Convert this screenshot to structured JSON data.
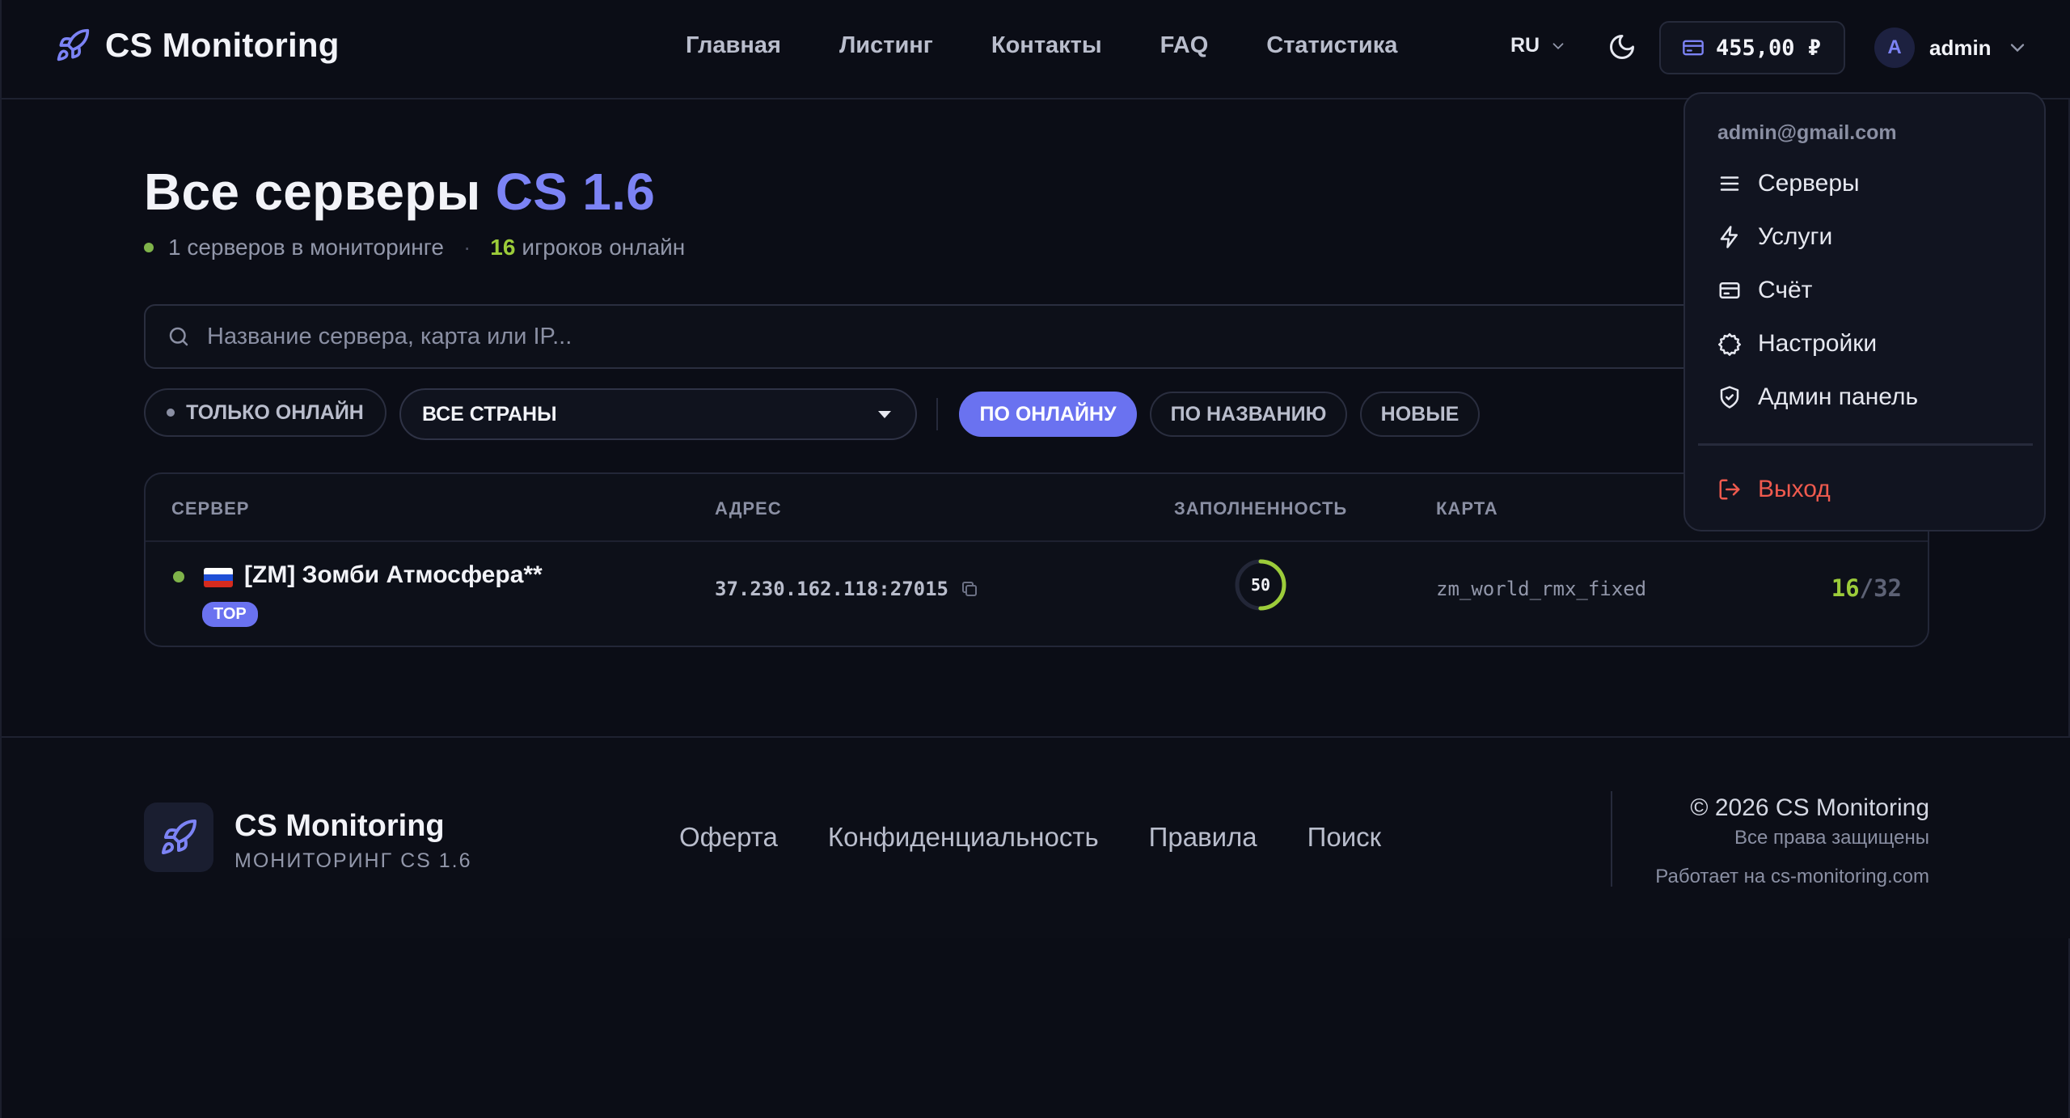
{
  "header": {
    "brand": "CS Monitoring",
    "nav": [
      "Главная",
      "Листинг",
      "Контакты",
      "FAQ",
      "Статистика"
    ],
    "lang": "RU",
    "balance": "455,00 ₽",
    "user": {
      "avatar_letter": "A",
      "name": "admin"
    }
  },
  "user_menu": {
    "email": "admin@gmail.com",
    "items": [
      "Серверы",
      "Услуги",
      "Счёт",
      "Настройки",
      "Админ панель"
    ],
    "logout": "Выход"
  },
  "main": {
    "title_prefix": "Все серверы",
    "title_accent": "CS 1.6",
    "servers_stat": "1 серверов в мониторинге",
    "players_count": "16",
    "players_label": "игроков онлайн",
    "search_placeholder": "Название сервера, карта или IP...",
    "filters": {
      "only_online": "ТОЛЬКО ОНЛАЙН",
      "country": "ВСЕ СТРАНЫ",
      "sort_online": "ПО ОНЛАЙНУ",
      "sort_name": "ПО НАЗВАНИЮ",
      "sort_new": "НОВЫЕ"
    },
    "table": {
      "headers": {
        "server": "СЕРВЕР",
        "address": "АДРЕС",
        "fill": "ЗАПОЛНЕННОСТЬ",
        "map": "КАРТА"
      },
      "rows": [
        {
          "name": "[ZM] Зомби Атмосфера**",
          "badge": "TOP",
          "address": "37.230.162.118:27015",
          "fill_percent": 50,
          "fill_label": "50",
          "map": "zm_world_rmx_fixed",
          "players_online": "16",
          "players_max": "32"
        }
      ]
    }
  },
  "footer": {
    "brand": "CS Monitoring",
    "subtitle": "МОНИТОРИНГ CS 1.6",
    "links": [
      "Оферта",
      "Конфиденциальность",
      "Правила",
      "Поиск"
    ],
    "copyright": "© 2026 CS Monitoring",
    "rights": "Все права защищены",
    "powered": "Работает на cs-monitoring.com"
  },
  "colors": {
    "accent": "#7c83f5",
    "accent_button": "#6a72f0",
    "online_green": "#9ccc3a",
    "status_dot": "#7fb34a",
    "logout_red": "#ef5a4e",
    "background": "#0b0d16"
  },
  "icons": [
    "rocket-icon",
    "chevron-down-icon",
    "moon-icon",
    "wallet-icon",
    "list-icon",
    "lightning-icon",
    "card-icon",
    "gear-icon",
    "shield-icon",
    "logout-icon",
    "search-icon",
    "copy-icon",
    "russia-flag-icon"
  ]
}
